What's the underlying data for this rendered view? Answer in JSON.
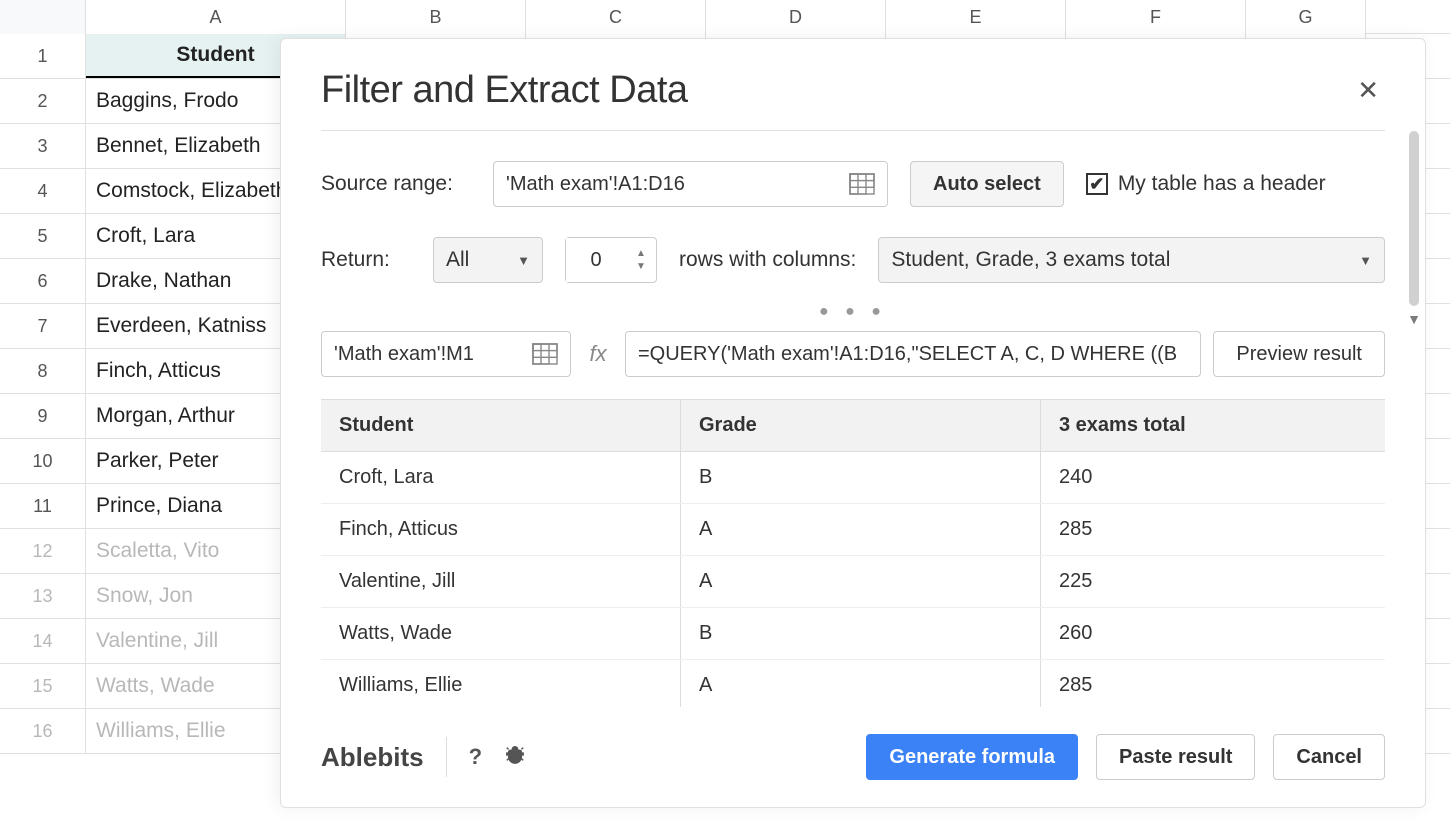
{
  "sheet": {
    "columns": [
      "A",
      "B",
      "C",
      "D",
      "E",
      "F",
      "G"
    ],
    "col_widths": {
      "A": 260,
      "B": 180,
      "C": 180,
      "D": 180,
      "E": 180,
      "F": 180,
      "G": 120
    },
    "rows": [
      {
        "n": "1",
        "A": "Student",
        "header": true
      },
      {
        "n": "2",
        "A": "Baggins, Frodo"
      },
      {
        "n": "3",
        "A": "Bennet, Elizabeth"
      },
      {
        "n": "4",
        "A": "Comstock, Elizabeth"
      },
      {
        "n": "5",
        "A": "Croft, Lara"
      },
      {
        "n": "6",
        "A": "Drake, Nathan"
      },
      {
        "n": "7",
        "A": "Everdeen, Katniss"
      },
      {
        "n": "8",
        "A": "Finch, Atticus"
      },
      {
        "n": "9",
        "A": "Morgan, Arthur"
      },
      {
        "n": "10",
        "A": "Parker, Peter"
      },
      {
        "n": "11",
        "A": "Prince, Diana"
      },
      {
        "n": "12",
        "A": "Scaletta, Vito",
        "faded": true
      },
      {
        "n": "13",
        "A": "Snow, Jon",
        "faded": true
      },
      {
        "n": "14",
        "A": "Valentine, Jill",
        "faded": true
      },
      {
        "n": "15",
        "A": "Watts, Wade",
        "faded": true
      },
      {
        "n": "16",
        "A": "Williams, Ellie",
        "faded": true
      }
    ]
  },
  "dialog": {
    "title": "Filter and Extract Data",
    "source_label": "Source range:",
    "source_value": "'Math exam'!A1:D16",
    "auto_select": "Auto select",
    "header_checkbox": {
      "checked": true,
      "label": "My table has a header"
    },
    "return_label": "Return:",
    "return_mode": "All",
    "return_count": "0",
    "rows_with_label": "rows with columns:",
    "columns_selected": "Student, Grade, 3 exams total",
    "dest_value": "'Math exam'!M1",
    "fx_label": "fx",
    "formula_value": "=QUERY('Math exam'!A1:D16,\"SELECT A, C, D WHERE ((B",
    "preview_label": "Preview result",
    "results": {
      "headers": [
        "Student",
        "Grade",
        "3 exams total"
      ],
      "rows": [
        [
          "Croft, Lara",
          "B",
          "240"
        ],
        [
          "Finch, Atticus",
          "A",
          "285"
        ],
        [
          "Valentine, Jill",
          "A",
          "225"
        ],
        [
          "Watts, Wade",
          "B",
          "260"
        ],
        [
          "Williams, Ellie",
          "A",
          "285"
        ]
      ]
    },
    "brand": "Ablebits",
    "help": "?",
    "generate": "Generate formula",
    "paste": "Paste result",
    "cancel": "Cancel"
  }
}
